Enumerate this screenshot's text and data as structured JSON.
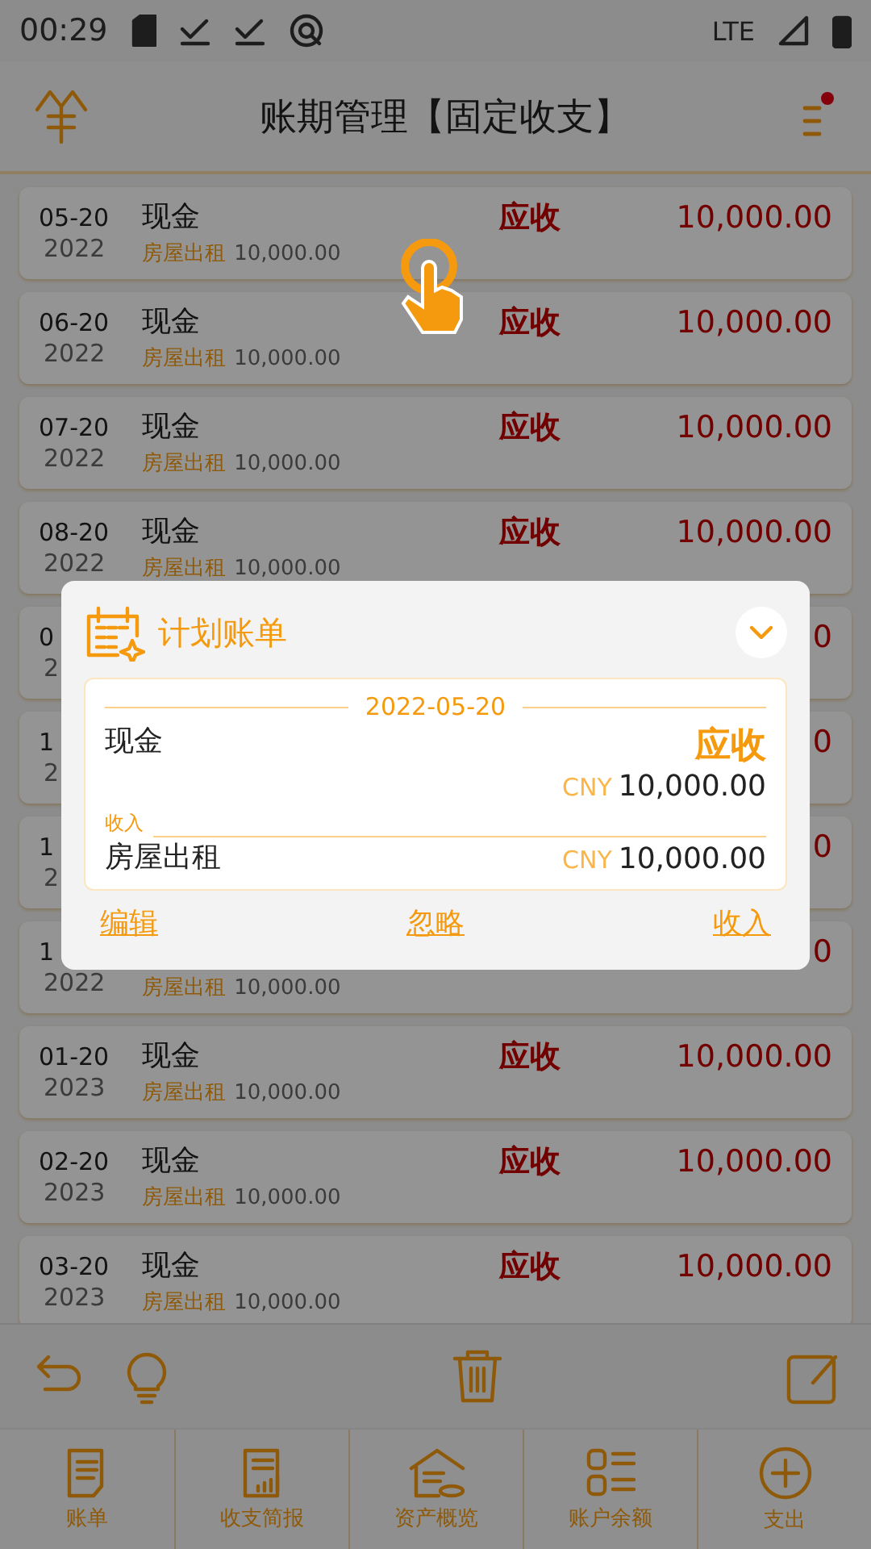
{
  "status_bar": {
    "time": "00:29",
    "network": "LTE"
  },
  "header": {
    "title": "账期管理【固定收支】",
    "notification_dot": true
  },
  "bills": [
    {
      "date": "05-20",
      "year": "2022",
      "account": "现金",
      "category": "房屋出租",
      "category_amount": "10,000.00",
      "status": "应收",
      "amount": "10,000.00"
    },
    {
      "date": "06-20",
      "year": "2022",
      "account": "现金",
      "category": "房屋出租",
      "category_amount": "10,000.00",
      "status": "应收",
      "amount": "10,000.00"
    },
    {
      "date": "07-20",
      "year": "2022",
      "account": "现金",
      "category": "房屋出租",
      "category_amount": "10,000.00",
      "status": "应收",
      "amount": "10,000.00"
    },
    {
      "date": "08-20",
      "year": "2022",
      "account": "现金",
      "category": "房屋出租",
      "category_amount": "10,000.00",
      "status": "应收",
      "amount": "10,000.00"
    },
    {
      "date": "0",
      "year": "2",
      "amount": "0"
    },
    {
      "date": "1",
      "year": "2",
      "amount": "0"
    },
    {
      "date": "1",
      "year": "2",
      "amount": "0"
    },
    {
      "date": "1",
      "year": "2022",
      "category": "房屋出租",
      "category_amount": "10,000.00",
      "amount": "0"
    },
    {
      "date": "01-20",
      "year": "2023",
      "account": "现金",
      "category": "房屋出租",
      "category_amount": "10,000.00",
      "status": "应收",
      "amount": "10,000.00"
    },
    {
      "date": "02-20",
      "year": "2023",
      "account": "现金",
      "category": "房屋出租",
      "category_amount": "10,000.00",
      "status": "应收",
      "amount": "10,000.00"
    },
    {
      "date": "03-20",
      "year": "2023",
      "account": "现金",
      "category": "房屋出租",
      "category_amount": "10,000.00",
      "status": "应收",
      "amount": "10,000.00"
    }
  ],
  "dialog": {
    "title": "计划账单",
    "date": "2022-05-20",
    "account": "现金",
    "status": "应收",
    "currency": "CNY",
    "amount": "10,000.00",
    "type_label": "收入",
    "category": "房屋出租",
    "category_currency": "CNY",
    "category_amount": "10,000.00",
    "actions": [
      "编辑",
      "忽略",
      "收入"
    ]
  },
  "nav": [
    {
      "label": "账单",
      "kind": "bill"
    },
    {
      "label": "收支简报",
      "kind": "report"
    },
    {
      "label": "资产概览",
      "kind": "assets"
    },
    {
      "label": "账户余额",
      "kind": "balance"
    },
    {
      "label": "支出",
      "kind": "add"
    }
  ]
}
